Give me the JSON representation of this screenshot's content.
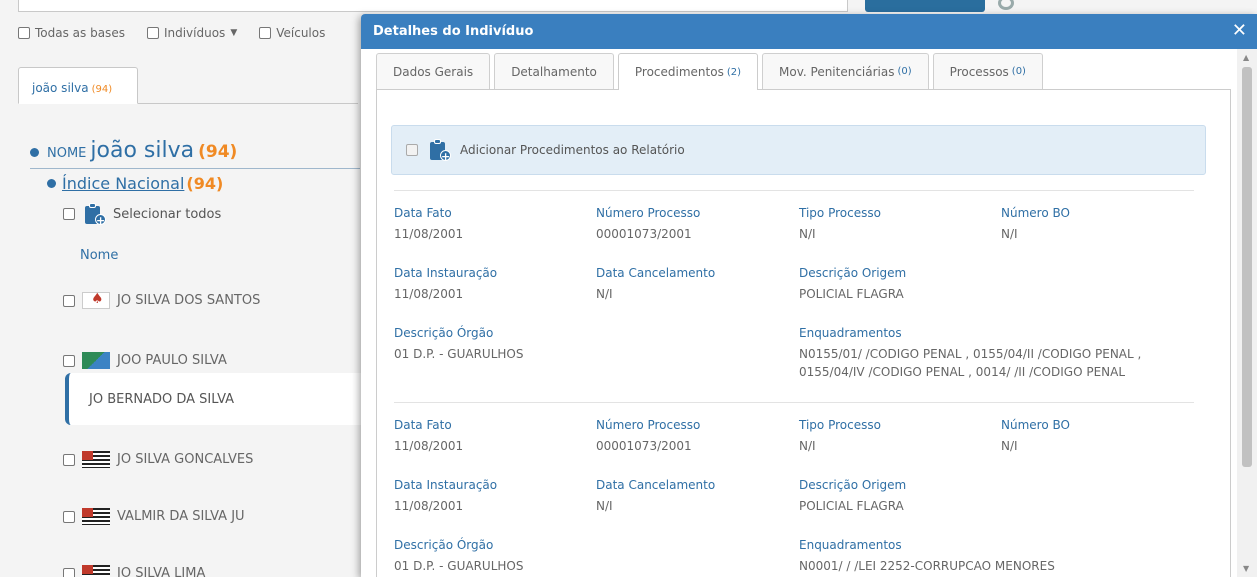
{
  "background": {
    "filters": [
      {
        "label": "Todas as bases",
        "has_caret": false
      },
      {
        "label": "Indivíduos",
        "has_caret": true
      },
      {
        "label": "Veículos",
        "has_caret": false
      }
    ],
    "search_tab": {
      "label": "joão silva",
      "count": "(94)"
    },
    "nome": {
      "prefix": "NOME",
      "name": "joão silva",
      "count": "(94)"
    },
    "indice": {
      "label": "Índice Nacional",
      "count": "(94)"
    },
    "select_all": "Selecionar todos",
    "nome_header": "Nome",
    "rows": [
      {
        "name": "JO SILVA DOS SANTOS",
        "flag": "red"
      },
      {
        "name": "JOO PAULO SILVA",
        "flag": "green"
      },
      {
        "name": "JO BERNADO DA SILVA",
        "flag": "none"
      },
      {
        "name": "JO SILVA GONCALVES",
        "flag": "sp"
      },
      {
        "name": "VALMIR DA SILVA JU",
        "flag": "sp"
      },
      {
        "name": "JO SILVA LIMA",
        "flag": "sp"
      }
    ]
  },
  "modal": {
    "title": "Detalhes do Indivíduo",
    "close": "✕",
    "tabs": [
      {
        "label": "Dados Gerais",
        "count": ""
      },
      {
        "label": "Detalhamento",
        "count": ""
      },
      {
        "label": "Procedimentos",
        "count": "(2)"
      },
      {
        "label": "Mov. Penitenciárias",
        "count": "(0)"
      },
      {
        "label": "Processos",
        "count": "(0)"
      }
    ],
    "active_tab": "Procedimentos",
    "add_label": "Adicionar Procedimentos ao Relatório",
    "labels": {
      "data_fato": "Data Fato",
      "numero_processo": "Número Processo",
      "tipo_processo": "Tipo Processo",
      "numero_bo": "Número BO",
      "data_instauracao": "Data Instauração",
      "data_cancelamento": "Data Cancelamento",
      "descricao_origem": "Descrição Origem",
      "descricao_orgao": "Descrição Órgão",
      "enquadramentos": "Enquadramentos"
    },
    "records": [
      {
        "data_fato": "11/08/2001",
        "numero_processo": "00001073/2001",
        "tipo_processo": "N/I",
        "numero_bo": "N/I",
        "data_instauracao": "11/08/2001",
        "data_cancelamento": "N/I",
        "descricao_origem": "POLICIAL FLAGRA",
        "descricao_orgao": "01 D.P. - GUARULHOS",
        "enquadramentos": "N0155/01/ /CODIGO PENAL , 0155/04/II /CODIGO PENAL ,\n0155/04/IV /CODIGO PENAL , 0014/ /II /CODIGO PENAL"
      },
      {
        "data_fato": "11/08/2001",
        "numero_processo": "00001073/2001",
        "tipo_processo": "N/I",
        "numero_bo": "N/I",
        "data_instauracao": "11/08/2001",
        "data_cancelamento": "N/I",
        "descricao_origem": "POLICIAL FLAGRA",
        "descricao_orgao": "01 D.P. - GUARULHOS",
        "enquadramentos": "N0001/ / /LEI 2252-CORRUPCAO MENORES"
      }
    ]
  },
  "colors": {
    "header_blue": "#3a7fbf",
    "link_blue": "#2f6fa5",
    "count_orange": "#f08a24",
    "add_bar_bg": "#e3eef7"
  }
}
